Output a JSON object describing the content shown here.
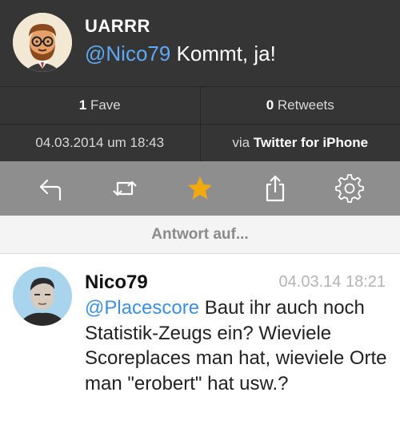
{
  "tweet": {
    "author": "UARRR",
    "mention": "@Nico79",
    "text": "Kommt, ja!",
    "faves_count": "1",
    "faves_label": "Fave",
    "retweets_count": "0",
    "retweets_label": "Retweets",
    "timestamp": "04.03.2014 um 18:43",
    "via_prefix": "via",
    "source": "Twitter for iPhone"
  },
  "toolbar": {
    "icons": [
      "reply-icon",
      "retweet-icon",
      "favorite-star-icon",
      "share-icon",
      "settings-gear-icon"
    ],
    "star_color": "#f2a90f",
    "icon_color": "#ffffff"
  },
  "reply_header": "Antwort auf...",
  "in_reply_to": {
    "author": "Nico79",
    "time": "04.03.14 18:21",
    "mention": "@Placescore",
    "text": "Baut ihr auch noch Statistik-Zeugs ein? Wieviele Scoreplaces man hat, wieviele Orte man \"erobert\" hat usw.?"
  },
  "colors": {
    "header_bg": "#353535",
    "toolbar_bg": "#8e8e8e",
    "mention": "#5ea9f4"
  }
}
